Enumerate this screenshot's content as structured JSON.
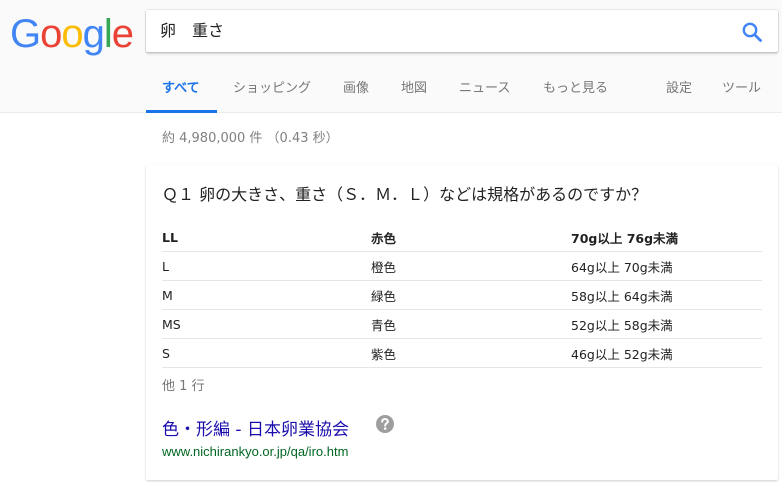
{
  "search": {
    "query": "卵　重さ",
    "icon": "search-icon"
  },
  "logo": {
    "letters": [
      "G",
      "o",
      "o",
      "g",
      "l",
      "e"
    ],
    "colors": [
      "#4285f4",
      "#ea4335",
      "#fbbc05",
      "#4285f4",
      "#34a853",
      "#ea4335"
    ]
  },
  "tabs": {
    "all": "すべて",
    "shopping": "ショッピング",
    "images": "画像",
    "maps": "地図",
    "news": "ニュース",
    "more": "もっと見る",
    "settings": "設定",
    "tools": "ツール"
  },
  "result_stats": "約 4,980,000 件 （0.43 秒）",
  "snippet": {
    "question": "Ｑ１ 卵の大きさ、重さ（Ｓ．Ｍ．Ｌ）などは規格があるのですか？",
    "table_header": [
      "LL",
      "赤色",
      "70g以上 76g未満"
    ],
    "table_rows": [
      [
        "L",
        "橙色",
        "64g以上 70g未満"
      ],
      [
        "M",
        "緑色",
        "58g以上 64g未満"
      ],
      [
        "MS",
        "青色",
        "52g以上 58g未満"
      ],
      [
        "S",
        "紫色",
        "46g以上 52g未満"
      ]
    ],
    "more_rows": "他 1 行",
    "link_title": "色・形編 - 日本卵業協会",
    "url": "www.nichirankyo.or.jp/qa/iro.htm",
    "help_icon": "question-mark-icon"
  },
  "colors": {
    "accent": "#1a73e8",
    "link": "#1a0dab",
    "url": "#006621"
  }
}
